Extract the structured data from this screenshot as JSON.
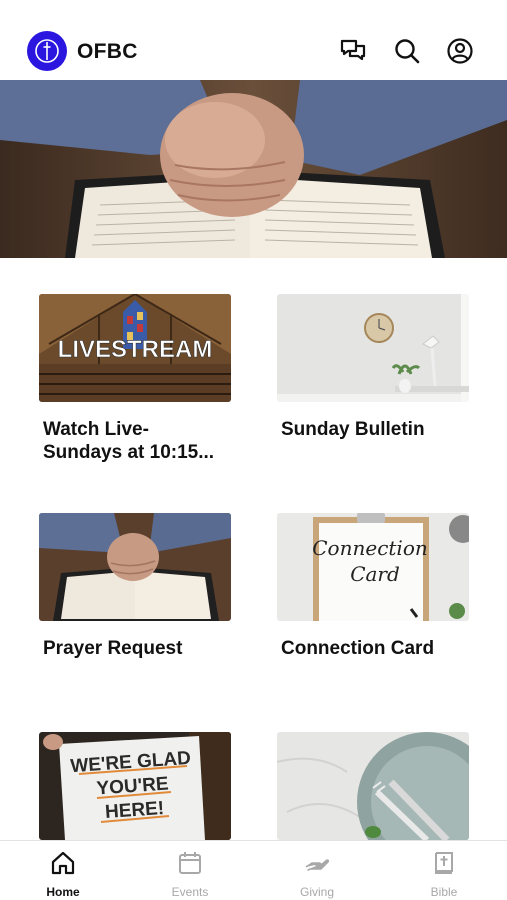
{
  "header": {
    "title": "OFBC",
    "logo_icon": "church-cross-logo-icon",
    "actions": [
      {
        "icon": "chat-icon"
      },
      {
        "icon": "search-icon"
      },
      {
        "icon": "profile-icon"
      }
    ],
    "logo_color": "#2b16e0"
  },
  "hero": {
    "image": "praying-hands-on-bible"
  },
  "cards": [
    {
      "label": "Watch Live- Sundays at 10:15...",
      "image": "livestream-church-interior",
      "thumb_text": "LIVESTREAM"
    },
    {
      "label": "Sunday Bulletin",
      "image": "clock-and-plant-on-shelf"
    },
    {
      "label": "Prayer Request",
      "image": "praying-hands-on-bible"
    },
    {
      "label": "Connection Card",
      "image": "connection-card-clipboard",
      "thumb_text_1": "Connection",
      "thumb_text_2": "Card"
    },
    {
      "label": "",
      "image": "were-glad-youre-here-sign",
      "thumb_text_1": "WE'RE GLAD",
      "thumb_text_2": "YOU'RE",
      "thumb_text_3": "HERE!"
    },
    {
      "label": "",
      "image": "plate-fork-and-knife"
    }
  ],
  "tabs": [
    {
      "label": "Home",
      "icon": "home-icon",
      "active": true
    },
    {
      "label": "Events",
      "icon": "calendar-icon",
      "active": false
    },
    {
      "label": "Giving",
      "icon": "giving-hand-icon",
      "active": false
    },
    {
      "label": "Bible",
      "icon": "bible-icon",
      "active": false
    }
  ],
  "colors": {
    "active_tab": "#111111",
    "inactive_tab": "#a8a8a8"
  }
}
